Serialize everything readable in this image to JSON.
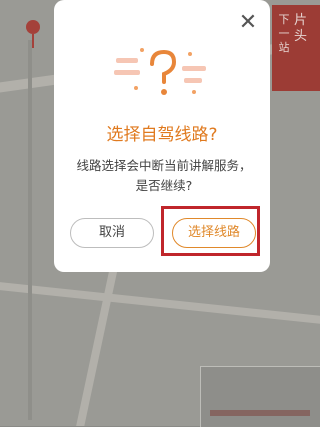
{
  "side_card": {
    "line1": "下一站",
    "line2": "片头"
  },
  "dialog": {
    "close_icon": "✕",
    "title": "选择自驾线路?",
    "message": "线路选择会中断当前讲解服务，是否继续?",
    "cancel_label": "取消",
    "confirm_label": "选择线路"
  },
  "colors": {
    "accent": "#e07a1f",
    "highlight_border": "#c0262b",
    "side_card": "#9c3c35"
  }
}
